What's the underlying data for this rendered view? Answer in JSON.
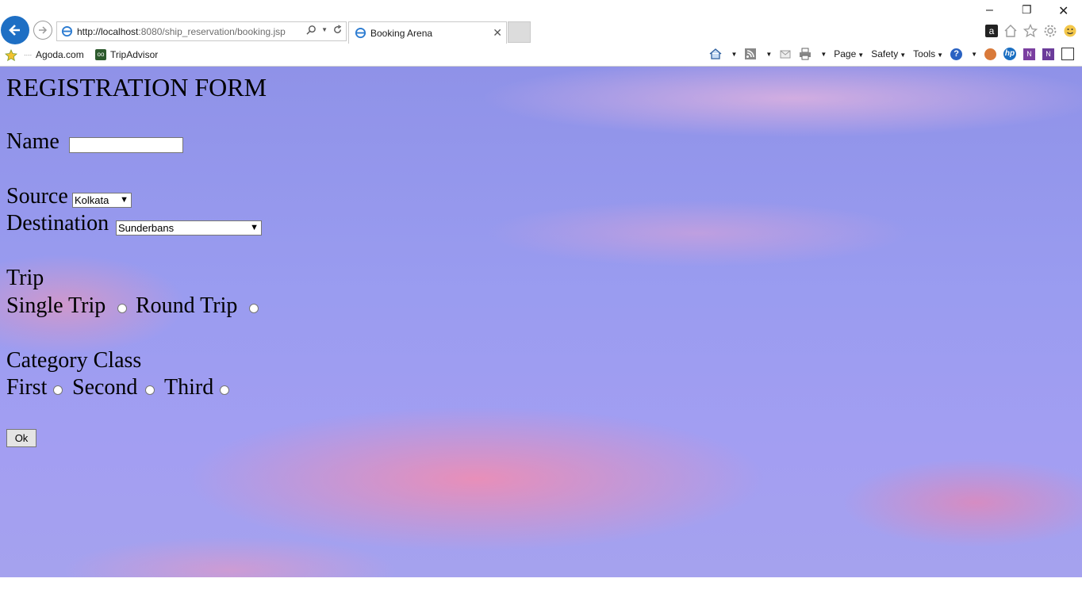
{
  "browser": {
    "url_host": "http://localhost",
    "url_rest": ":8080/ship_reservation/booking.jsp",
    "tab_title": "Booking Arena",
    "favorites": [
      "Agoda.com",
      "TripAdvisor"
    ],
    "commands": [
      "Page",
      "Safety",
      "Tools"
    ]
  },
  "form": {
    "heading": "REGISTRATION FORM",
    "name_label": "Name",
    "name_value": "",
    "source_label": "Source",
    "source_value": "Kolkata",
    "destination_label": "Destination",
    "destination_value": "Sunderbans",
    "trip_label": "Trip",
    "trip_options": [
      "Single Trip",
      "Round Trip"
    ],
    "category_label": "Category Class",
    "class_options": [
      "First",
      "Second",
      "Third"
    ],
    "ok_label": "Ok"
  },
  "colors": {
    "back_button": "#1e6fc4",
    "sky_top": "#8f92e8",
    "cloud_pink": "#f48caf"
  }
}
